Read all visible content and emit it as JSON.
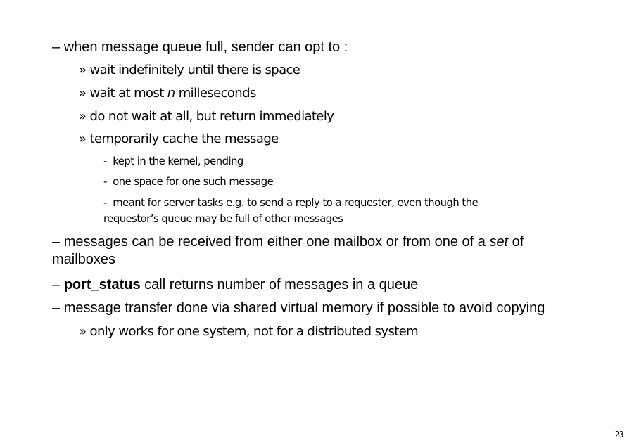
{
  "bullets": {
    "b1": {
      "marker": "–",
      "text": "when message queue full, sender can opt to :"
    },
    "b1_1": {
      "marker": "»",
      "text": "wait indefinitely until there is space"
    },
    "b1_2": {
      "marker": "»",
      "pre": "wait at most ",
      "italic": "n",
      "post": " milleseconds"
    },
    "b1_3": {
      "marker": "»",
      "text": "do not wait at all, but return immediately"
    },
    "b1_4": {
      "marker": "»",
      "text": "temporarily cache the message"
    },
    "b1_4_1": {
      "marker": "-",
      "text": "kept in the kernel, pending"
    },
    "b1_4_2": {
      "marker": "-",
      "text": "one space for one such message"
    },
    "b1_4_3": {
      "marker": "-",
      "text": "meant for server tasks e.g. to send a reply to a requester, even though the",
      "cont": "requestor’s queue may be full of other messages"
    },
    "b2": {
      "marker": "–",
      "pre": "messages can be received from either one mailbox or from one of a ",
      "italic": "set",
      "post": " of",
      "cont": "mailboxes"
    },
    "b3": {
      "marker": "–",
      "bold": "port_status",
      "post": " call returns number of messages in a queue"
    },
    "b4": {
      "marker": "–",
      "text": "message transfer done via shared virtual memory if possible to avoid copying"
    },
    "b4_1": {
      "marker": "»",
      "text": "only works for one system, not for a distributed system"
    }
  },
  "page_number": "23"
}
